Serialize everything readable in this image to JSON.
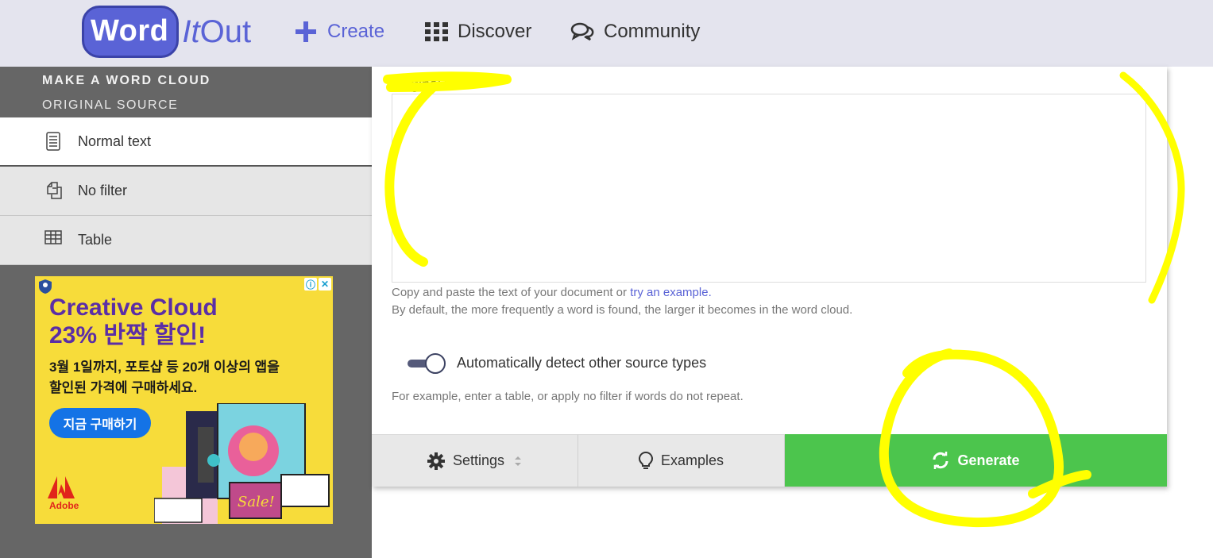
{
  "nav": {
    "logo": {
      "word": "Word",
      "it": "It",
      "out": "Out"
    },
    "create": "Create",
    "discover": "Discover",
    "community": "Community"
  },
  "sidebar": {
    "title": "MAKE A WORD CLOUD",
    "subtitle": "ORIGINAL SOURCE",
    "items": [
      {
        "label": "Normal text",
        "icon": "document-icon",
        "active": true
      },
      {
        "label": "No filter",
        "icon": "copy-icon",
        "active": false
      },
      {
        "label": "Table",
        "icon": "table-icon",
        "active": false
      }
    ]
  },
  "ad": {
    "headline1": "Creative Cloud",
    "headline2": "23% 반짝 할인!",
    "body": "3월 1일까지, 포토샵 등 20개 이상의 앱을 할인된 가격에 구매하세요.",
    "cta": "지금 구매하기",
    "brand": "Adobe",
    "art_text": "Sale!"
  },
  "main": {
    "field_label": "Original text",
    "textarea_value": "",
    "help_prefix": "Copy and paste the text of your document or ",
    "help_link": "try an example.",
    "help2": "By default, the more frequently a word is found, the larger it becomes in the word cloud.",
    "toggle_label": "Automatically detect other source types",
    "toggle_on": true,
    "help3": "For example, enter a table, or apply no filter if words do not repeat."
  },
  "buttons": {
    "settings": "Settings",
    "examples": "Examples",
    "generate": "Generate"
  },
  "colors": {
    "brand": "#5a63d6",
    "generate_green": "#4cc54d",
    "sidebar_gray": "#666666",
    "annotation_yellow": "#ffff00",
    "ad_yellow": "#f7dc3a",
    "ad_purple": "#5b2ea6"
  }
}
